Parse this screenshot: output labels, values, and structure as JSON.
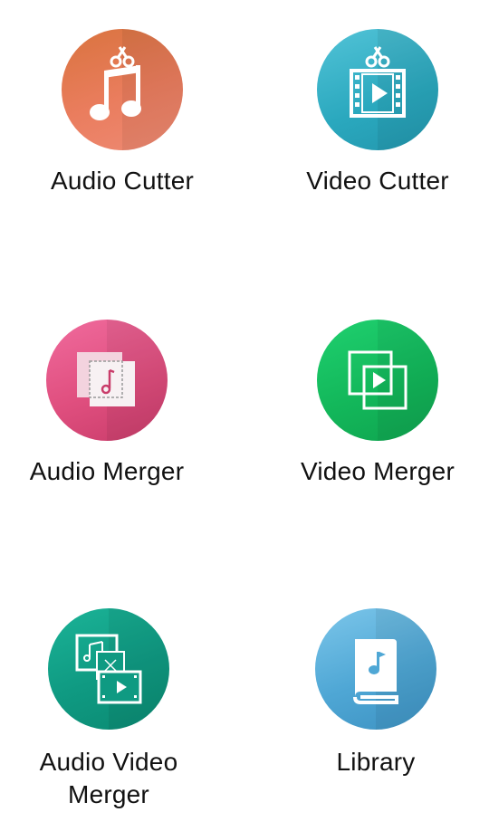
{
  "tiles": [
    {
      "label": "Audio Cutter",
      "icon": "audio-cutter-icon"
    },
    {
      "label": "Video Cutter",
      "icon": "video-cutter-icon"
    },
    {
      "label": "Audio Merger",
      "icon": "audio-merger-icon"
    },
    {
      "label": "Video Merger",
      "icon": "video-merger-icon"
    },
    {
      "label_line1": "Audio Video",
      "label_line2": "Merger",
      "icon": "audio-video-merger-icon"
    },
    {
      "label": "Library",
      "icon": "library-icon"
    }
  ],
  "colors": {
    "audio_cutter": "#e67a55",
    "video_cutter": "#34b2c7",
    "audio_merger": "#e45385",
    "video_merger": "#16bd5f",
    "audio_video_merger": "#129f86",
    "library": "#57acd9"
  }
}
